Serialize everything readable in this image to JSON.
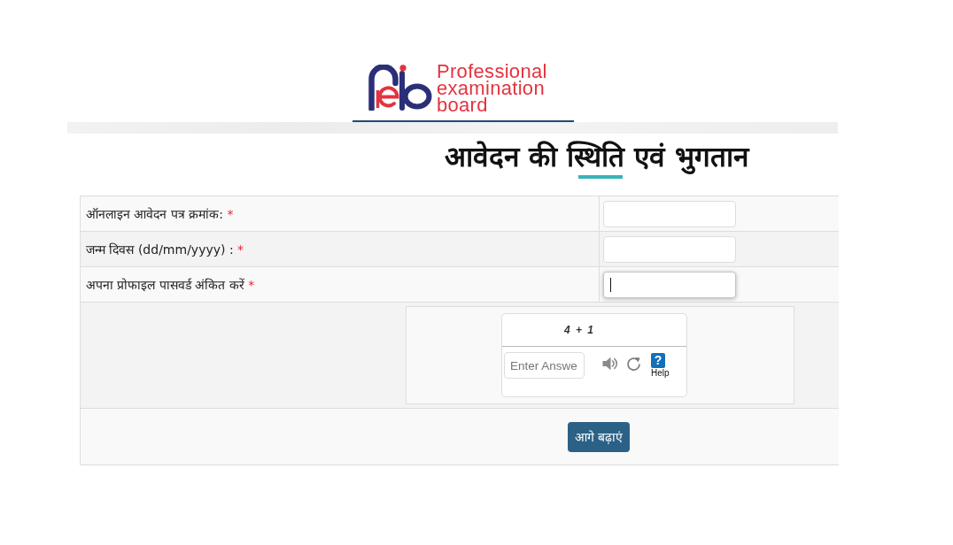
{
  "logo": {
    "lines": [
      "Professional",
      "examination",
      "board"
    ]
  },
  "title": "आवेदन की स्थिति एवं भुगतान",
  "fields": [
    {
      "label": "ऑनलाइन आवेदन पत्र क्रमांक:",
      "required_mark": "*",
      "focused": false
    },
    {
      "label": "जन्म दिवस (dd/mm/yyyy) :",
      "required_mark": "*",
      "focused": false
    },
    {
      "label": "अपना प्रोफाइल पासवर्ड अंकित करें",
      "required_mark": "*",
      "focused": true
    }
  ],
  "captcha": {
    "question": "4 + 1",
    "answer_placeholder": "Enter Answe",
    "help_symbol": "?",
    "help_label": "Help"
  },
  "submit_button": {
    "label": "आगे बढ़ाएं"
  }
}
